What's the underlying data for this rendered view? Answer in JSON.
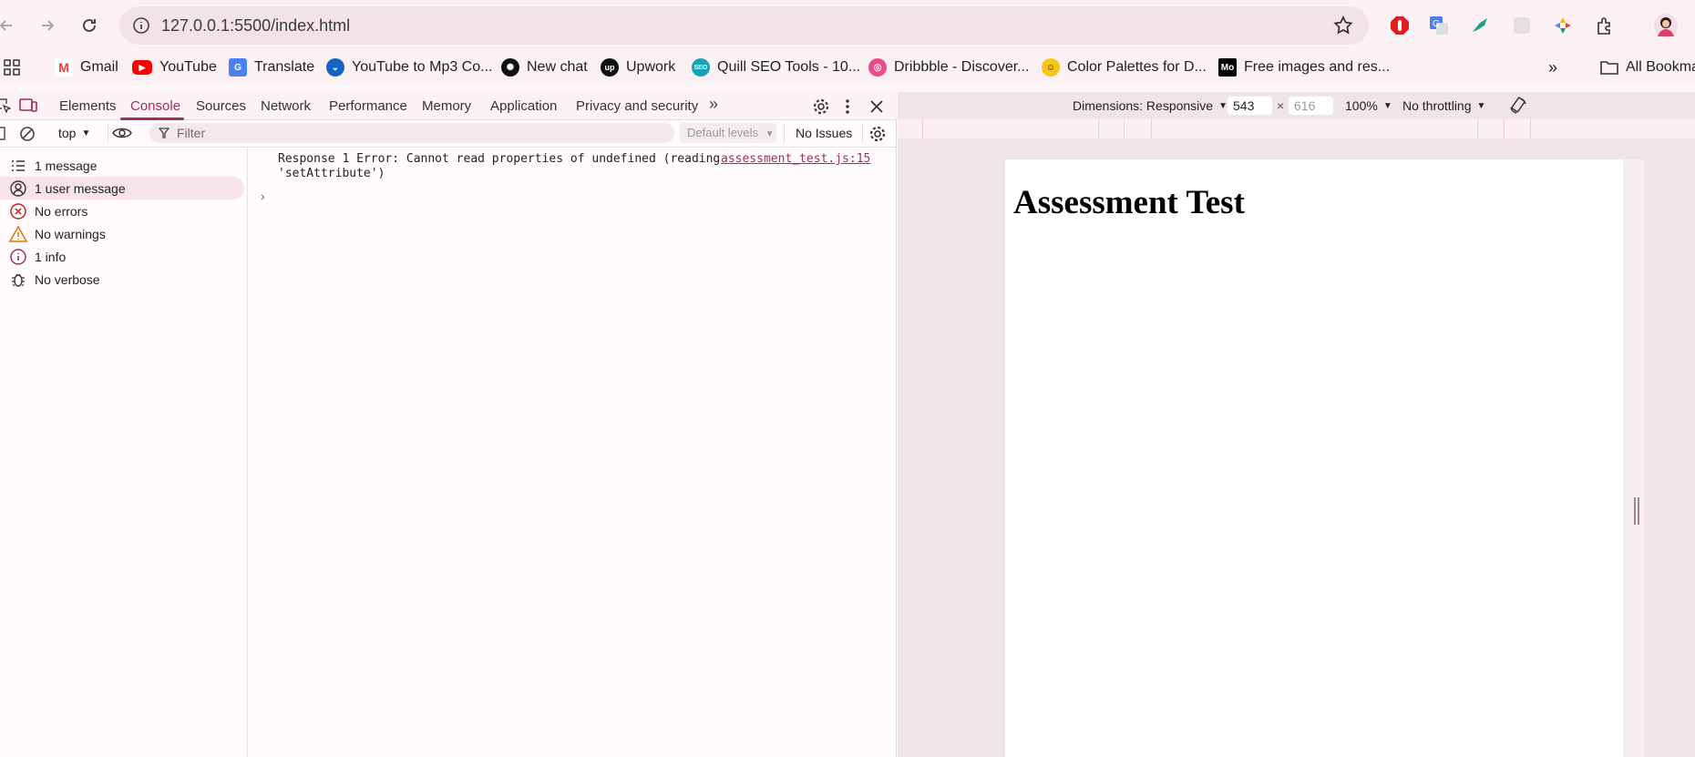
{
  "browser": {
    "url": "127.0.0.1:5500/index.html",
    "icons": [
      "back-icon",
      "forward-icon",
      "reload-icon",
      "site-info-icon",
      "bookmark-star-icon",
      "extensions-icon",
      "profile-avatar"
    ]
  },
  "bookmarks": {
    "items": [
      {
        "label": "Gmail",
        "icon": "gmail-icon"
      },
      {
        "label": "YouTube",
        "icon": "youtube-icon"
      },
      {
        "label": "Translate",
        "icon": "translate-icon"
      },
      {
        "label": "YouTube to Mp3 Co...",
        "icon": "youtube-mp3-icon"
      },
      {
        "label": "New chat",
        "icon": "chatgpt-icon"
      },
      {
        "label": "Upwork",
        "icon": "upwork-icon"
      },
      {
        "label": "Quill SEO Tools - 10...",
        "icon": "seo-icon"
      },
      {
        "label": "Dribbble - Discover...",
        "icon": "dribbble-icon"
      },
      {
        "label": "Color Palettes for D...",
        "icon": "palette-icon"
      },
      {
        "label": "Free images and res...",
        "icon": "medium-icon"
      }
    ],
    "all_bookmarks": "All Bookma"
  },
  "devtools": {
    "tabs": [
      "Elements",
      "Console",
      "Sources",
      "Network",
      "Performance",
      "Memory",
      "Application",
      "Privacy and security"
    ],
    "active_tab": "Console",
    "toolbar": {
      "context": "top",
      "filter_placeholder": "Filter",
      "levels": "Default levels",
      "issues": "No Issues"
    },
    "sidebar": [
      {
        "label": "1 message",
        "icon": "list-icon"
      },
      {
        "label": "1 user message",
        "icon": "user-icon"
      },
      {
        "label": "No errors",
        "icon": "error-icon"
      },
      {
        "label": "No warnings",
        "icon": "warning-icon"
      },
      {
        "label": "1 info",
        "icon": "info-icon"
      },
      {
        "label": "No verbose",
        "icon": "bug-icon"
      }
    ],
    "console": {
      "message": "Response 1 Error: Cannot read properties of undefined (reading\n'setAttribute')",
      "source": "assessment_test.js:15"
    }
  },
  "device_toolbar": {
    "dimensions_label": "Dimensions: Responsive",
    "width": "543",
    "times": "×",
    "height": "616",
    "zoom": "100%",
    "throttling": "No throttling"
  },
  "page": {
    "heading": "Assessment Test"
  },
  "colors": {
    "accent": "#a0304f",
    "error": "#c5221f",
    "warning": "#e37400"
  }
}
